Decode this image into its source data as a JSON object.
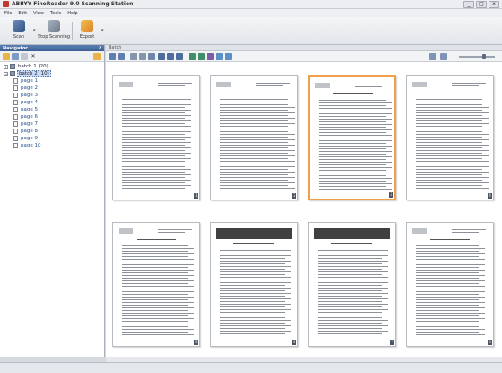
{
  "window": {
    "title": "ABBYY FineReader 9.0 Scanning Station",
    "controls": [
      "_",
      "□",
      "x"
    ]
  },
  "menu": [
    "File",
    "Edit",
    "View",
    "Tools",
    "Help"
  ],
  "toolbar": {
    "buttons": [
      {
        "label": "Scan",
        "icon": "scan-icon"
      },
      {
        "label": "Stop Scanning",
        "icon": "stop-scanning-icon"
      },
      {
        "label": "Export",
        "icon": "export-icon"
      }
    ]
  },
  "navigator": {
    "title": "Navigator",
    "close": "x",
    "batches": [
      {
        "label": "batch 1 (20)",
        "expanded": false
      },
      {
        "label": "batch 2 (10)",
        "expanded": true,
        "selected": true
      }
    ],
    "pages": [
      "page 1",
      "page 2",
      "page 3",
      "page 4",
      "page 5",
      "page 6",
      "page 7",
      "page 8",
      "page 9",
      "page 10"
    ]
  },
  "main": {
    "header": "Batch",
    "thumbnails": [
      {
        "label": "1",
        "selected": false
      },
      {
        "label": "2",
        "selected": false
      },
      {
        "label": "3",
        "selected": true
      },
      {
        "label": "4",
        "selected": false
      },
      {
        "label": "5",
        "selected": false
      },
      {
        "label": "6",
        "selected": false
      },
      {
        "label": "7",
        "selected": false
      },
      {
        "label": "8",
        "selected": false
      }
    ]
  },
  "colors": {
    "selection_border": "#f0a04a",
    "nav_header": "#3d5f94",
    "tree_link": "#23508f"
  }
}
